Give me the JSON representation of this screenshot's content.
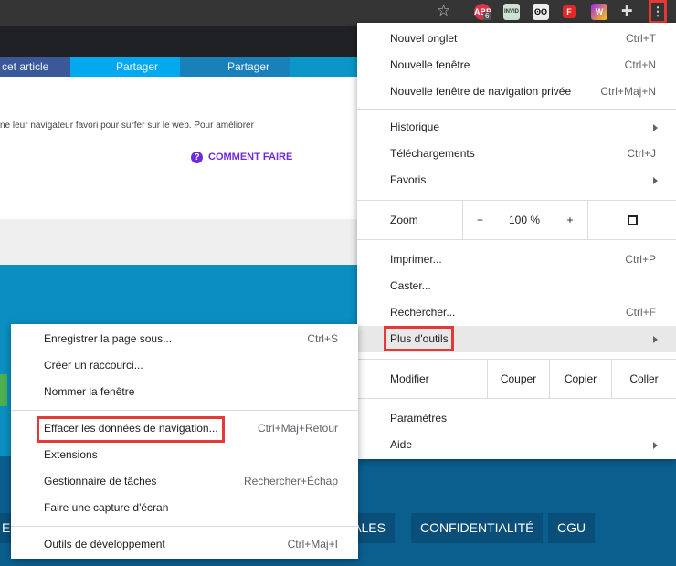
{
  "browser": {
    "extensions": [
      {
        "name": "abp",
        "label": "ABP",
        "badge": "6",
        "color": "#d8354a"
      },
      {
        "name": "invid",
        "label": "INVID",
        "color": "#cfe3d2"
      },
      {
        "name": "face",
        "label": "",
        "color": "#eeeeee"
      },
      {
        "name": "flipboard",
        "label": "F",
        "color": "#e12828"
      },
      {
        "name": "wn",
        "label": "W",
        "color": "#a020f0"
      }
    ]
  },
  "page": {
    "share": [
      {
        "label": "cet article"
      },
      {
        "label": "Partager"
      },
      {
        "label": "Partager"
      }
    ],
    "intro": "ne leur navigateur favori pour surfer sur le web. Pour améliorer",
    "how_to": "COMMENT FAIRE",
    "accent": "#6f2bd9",
    "footer": [
      "EI",
      "ALES",
      "CONFIDENTIALITÉ",
      "CGU"
    ]
  },
  "menu": {
    "new_tab": {
      "label": "Nouvel onglet",
      "shortcut": "Ctrl+T"
    },
    "new_window": {
      "label": "Nouvelle fenêtre",
      "shortcut": "Ctrl+N"
    },
    "incognito": {
      "label": "Nouvelle fenêtre de navigation privée",
      "shortcut": "Ctrl+Maj+N"
    },
    "history": {
      "label": "Historique"
    },
    "downloads": {
      "label": "Téléchargements",
      "shortcut": "Ctrl+J"
    },
    "bookmarks": {
      "label": "Favoris"
    },
    "zoom": {
      "label": "Zoom",
      "minus": "−",
      "value": "100 %",
      "plus": "+"
    },
    "print": {
      "label": "Imprimer...",
      "shortcut": "Ctrl+P"
    },
    "cast": {
      "label": "Caster..."
    },
    "find": {
      "label": "Rechercher...",
      "shortcut": "Ctrl+F"
    },
    "more_tools": {
      "label": "Plus d'outils"
    },
    "edit": {
      "label": "Modifier",
      "cut": "Couper",
      "copy": "Copier",
      "paste": "Coller"
    },
    "settings": {
      "label": "Paramètres"
    },
    "help": {
      "label": "Aide"
    }
  },
  "submenu": {
    "items": [
      {
        "label": "Enregistrer la page sous...",
        "shortcut": "Ctrl+S"
      },
      {
        "label": "Créer un raccourci..."
      },
      {
        "label": "Nommer la fenêtre"
      },
      {
        "label": "Effacer les données de navigation...",
        "shortcut": "Ctrl+Maj+Retour"
      },
      {
        "label": "Extensions"
      },
      {
        "label": "Gestionnaire de tâches",
        "shortcut": "Rechercher+Échap"
      },
      {
        "label": "Faire une capture d'écran"
      },
      {
        "label": "Outils de développement",
        "shortcut": "Ctrl+Maj+I"
      }
    ]
  }
}
